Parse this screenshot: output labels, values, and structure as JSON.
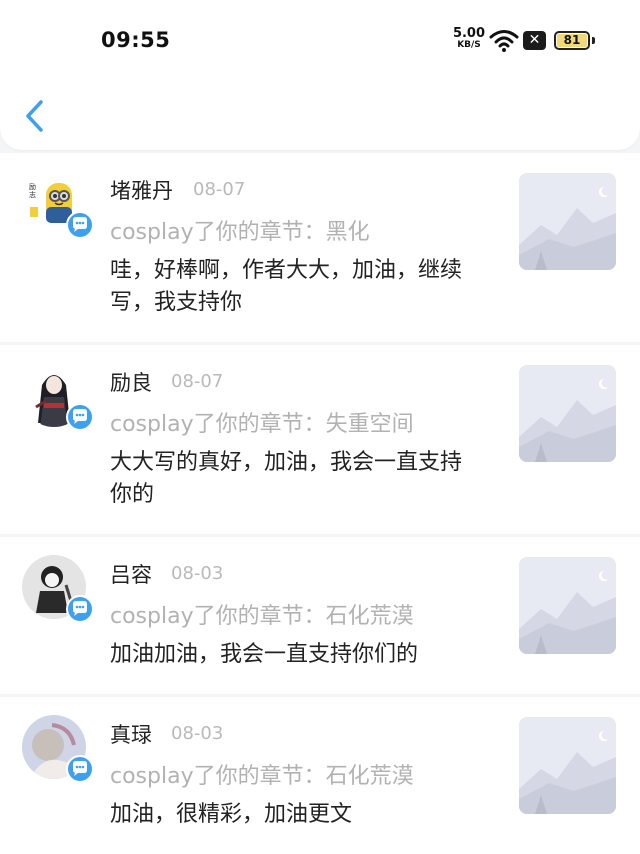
{
  "status_bar": {
    "time": "09:55",
    "net_speed_value": "5.00",
    "net_speed_unit": "KB/S",
    "battery_level": "81",
    "icons": [
      "wifi-icon",
      "close-icon",
      "battery-icon"
    ]
  },
  "header": {
    "back_icon": "chevron-left-icon"
  },
  "colors": {
    "accent": "#3fa0ee",
    "battery": "#f4d77a",
    "muted_text": "#b2b2b2"
  },
  "notifications": [
    {
      "name": "堵雅丹",
      "date": "08-07",
      "chapter": "cosplay了你的章节：黑化",
      "comment": "哇，好棒啊，作者大大，加油，继续写，我支持你"
    },
    {
      "name": "励良",
      "date": "08-07",
      "chapter": "cosplay了你的章节：失重空间",
      "comment": "大大写的真好，加油，我会一直支持你的"
    },
    {
      "name": "吕容",
      "date": "08-03",
      "chapter": "cosplay了你的章节：石化荒漠",
      "comment": "加油加油，我会一直支持你们的"
    },
    {
      "name": "真琭",
      "date": "08-03",
      "chapter": "cosplay了你的章节：石化荒漠",
      "comment": "加油，很精彩，加油更文"
    }
  ]
}
